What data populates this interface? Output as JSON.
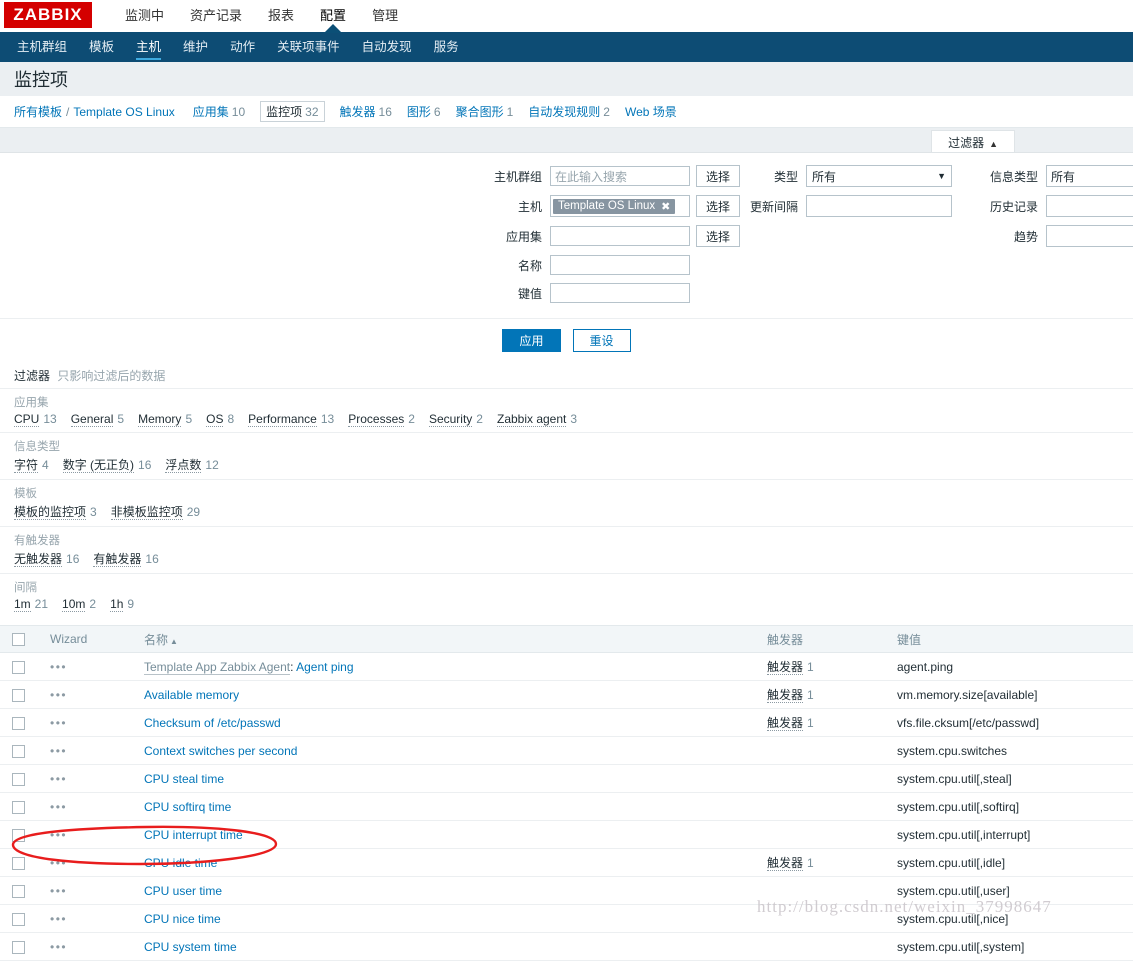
{
  "brand": {
    "logo_text": "ZABBIX",
    "logo_color": "#d40000"
  },
  "topnav": {
    "items": [
      {
        "label": "监测中",
        "active": false
      },
      {
        "label": "资产记录",
        "active": false
      },
      {
        "label": "报表",
        "active": false
      },
      {
        "label": "配置",
        "active": true
      },
      {
        "label": "管理",
        "active": false
      }
    ]
  },
  "subnav": {
    "items": [
      {
        "label": "主机群组",
        "active": false
      },
      {
        "label": "模板",
        "active": false
      },
      {
        "label": "主机",
        "active": true
      },
      {
        "label": "维护",
        "active": false
      },
      {
        "label": "动作",
        "active": false
      },
      {
        "label": "关联项事件",
        "active": false
      },
      {
        "label": "自动发现",
        "active": false
      },
      {
        "label": "服务",
        "active": false
      }
    ]
  },
  "page": {
    "title": "监控项"
  },
  "breadcrumb": {
    "root": "所有模板",
    "separator": "/",
    "current": "Template OS Linux",
    "tabs": [
      {
        "label": "应用集",
        "count": "10",
        "selected": false
      },
      {
        "label": "监控项",
        "count": "32",
        "selected": true
      },
      {
        "label": "触发器",
        "count": "16",
        "selected": false
      },
      {
        "label": "图形",
        "count": "6",
        "selected": false
      },
      {
        "label": "聚合图形",
        "count": "1",
        "selected": false
      },
      {
        "label": "自动发现规则",
        "count": "2",
        "selected": false
      },
      {
        "label": "Web 场景",
        "count": "",
        "selected": false
      }
    ]
  },
  "filter": {
    "tab_label": "过滤器",
    "tab_arrow": "▲",
    "col1": [
      {
        "label": "主机群组",
        "value": "",
        "placeholder": "在此输入搜索",
        "button": "选择"
      },
      {
        "label": "主机",
        "chip": "Template OS Linux",
        "chip_remove": "✖",
        "button": "选择"
      },
      {
        "label": "应用集",
        "value": "",
        "placeholder": "",
        "button": "选择"
      },
      {
        "label": "名称",
        "value": "",
        "placeholder": ""
      },
      {
        "label": "键值",
        "value": "",
        "placeholder": ""
      }
    ],
    "col2": [
      {
        "label": "类型",
        "value": "所有",
        "type": "select"
      },
      {
        "label": "更新间隔",
        "value": "",
        "type": "text"
      }
    ],
    "col3": [
      {
        "label": "信息类型",
        "value": "所有",
        "type": "text"
      },
      {
        "label": "历史记录",
        "value": "",
        "type": "text"
      },
      {
        "label": "趋势",
        "value": "",
        "type": "text"
      }
    ],
    "apply_label": "应用",
    "reset_label": "重设"
  },
  "subfilter": {
    "title": "过滤器",
    "hint": "只影响过滤后的数据",
    "groups": [
      {
        "title": "应用集",
        "items": [
          {
            "label": "CPU",
            "count": "13"
          },
          {
            "label": "General",
            "count": "5"
          },
          {
            "label": "Memory",
            "count": "5"
          },
          {
            "label": "OS",
            "count": "8"
          },
          {
            "label": "Performance",
            "count": "13"
          },
          {
            "label": "Processes",
            "count": "2"
          },
          {
            "label": "Security",
            "count": "2"
          },
          {
            "label": "Zabbix agent",
            "count": "3"
          }
        ]
      },
      {
        "title": "信息类型",
        "items": [
          {
            "label": "字符",
            "count": "4"
          },
          {
            "label": "数字 (无正负)",
            "count": "16"
          },
          {
            "label": "浮点数",
            "count": "12"
          }
        ]
      },
      {
        "title": "模板",
        "items": [
          {
            "label": "模板的监控项",
            "count": "3"
          },
          {
            "label": "非模板监控项",
            "count": "29"
          }
        ]
      },
      {
        "title": "有触发器",
        "items": [
          {
            "label": "无触发器",
            "count": "16"
          },
          {
            "label": "有触发器",
            "count": "16"
          }
        ]
      },
      {
        "title": "间隔",
        "items": [
          {
            "label": "1m",
            "count": "21"
          },
          {
            "label": "10m",
            "count": "2"
          },
          {
            "label": "1h",
            "count": "9"
          }
        ]
      }
    ]
  },
  "table": {
    "headers": {
      "wizard": "Wizard",
      "name": "名称",
      "name_sort": "▲",
      "triggers": "触发器",
      "key": "键值"
    },
    "dots": "•••",
    "rows": [
      {
        "prefix": "Template App Zabbix Agent",
        "name": "Agent ping",
        "trigger_label": "触发器",
        "trigger_count": "1",
        "key": "agent.ping",
        "highlight": false
      },
      {
        "prefix": "",
        "name": "Available memory",
        "trigger_label": "触发器",
        "trigger_count": "1",
        "key": "vm.memory.size[available]",
        "highlight": false
      },
      {
        "prefix": "",
        "name": "Checksum of /etc/passwd",
        "trigger_label": "触发器",
        "trigger_count": "1",
        "key": "vfs.file.cksum[/etc/passwd]",
        "highlight": false
      },
      {
        "prefix": "",
        "name": "Context switches per second",
        "trigger_label": "",
        "trigger_count": "",
        "key": "system.cpu.switches",
        "highlight": false
      },
      {
        "prefix": "",
        "name": "CPU steal time",
        "trigger_label": "",
        "trigger_count": "",
        "key": "system.cpu.util[,steal]",
        "highlight": false
      },
      {
        "prefix": "",
        "name": "CPU softirq time",
        "trigger_label": "",
        "trigger_count": "",
        "key": "system.cpu.util[,softirq]",
        "highlight": false
      },
      {
        "prefix": "",
        "name": "CPU interrupt time",
        "trigger_label": "",
        "trigger_count": "",
        "key": "system.cpu.util[,interrupt]",
        "highlight": false
      },
      {
        "prefix": "",
        "name": "CPU idle time",
        "trigger_label": "触发器",
        "trigger_count": "1",
        "key": "system.cpu.util[,idle]",
        "highlight": true
      },
      {
        "prefix": "",
        "name": "CPU user time",
        "trigger_label": "",
        "trigger_count": "",
        "key": "system.cpu.util[,user]",
        "highlight": false
      },
      {
        "prefix": "",
        "name": "CPU nice time",
        "trigger_label": "",
        "trigger_count": "",
        "key": "system.cpu.util[,nice]",
        "highlight": false
      },
      {
        "prefix": "",
        "name": "CPU system time",
        "trigger_label": "",
        "trigger_count": "",
        "key": "system.cpu.util[,system]",
        "highlight": false
      }
    ]
  },
  "annotation": {
    "ellipse_color": "#e81d1d",
    "watermark": "http://blog.csdn.net/weixin_37998647"
  }
}
